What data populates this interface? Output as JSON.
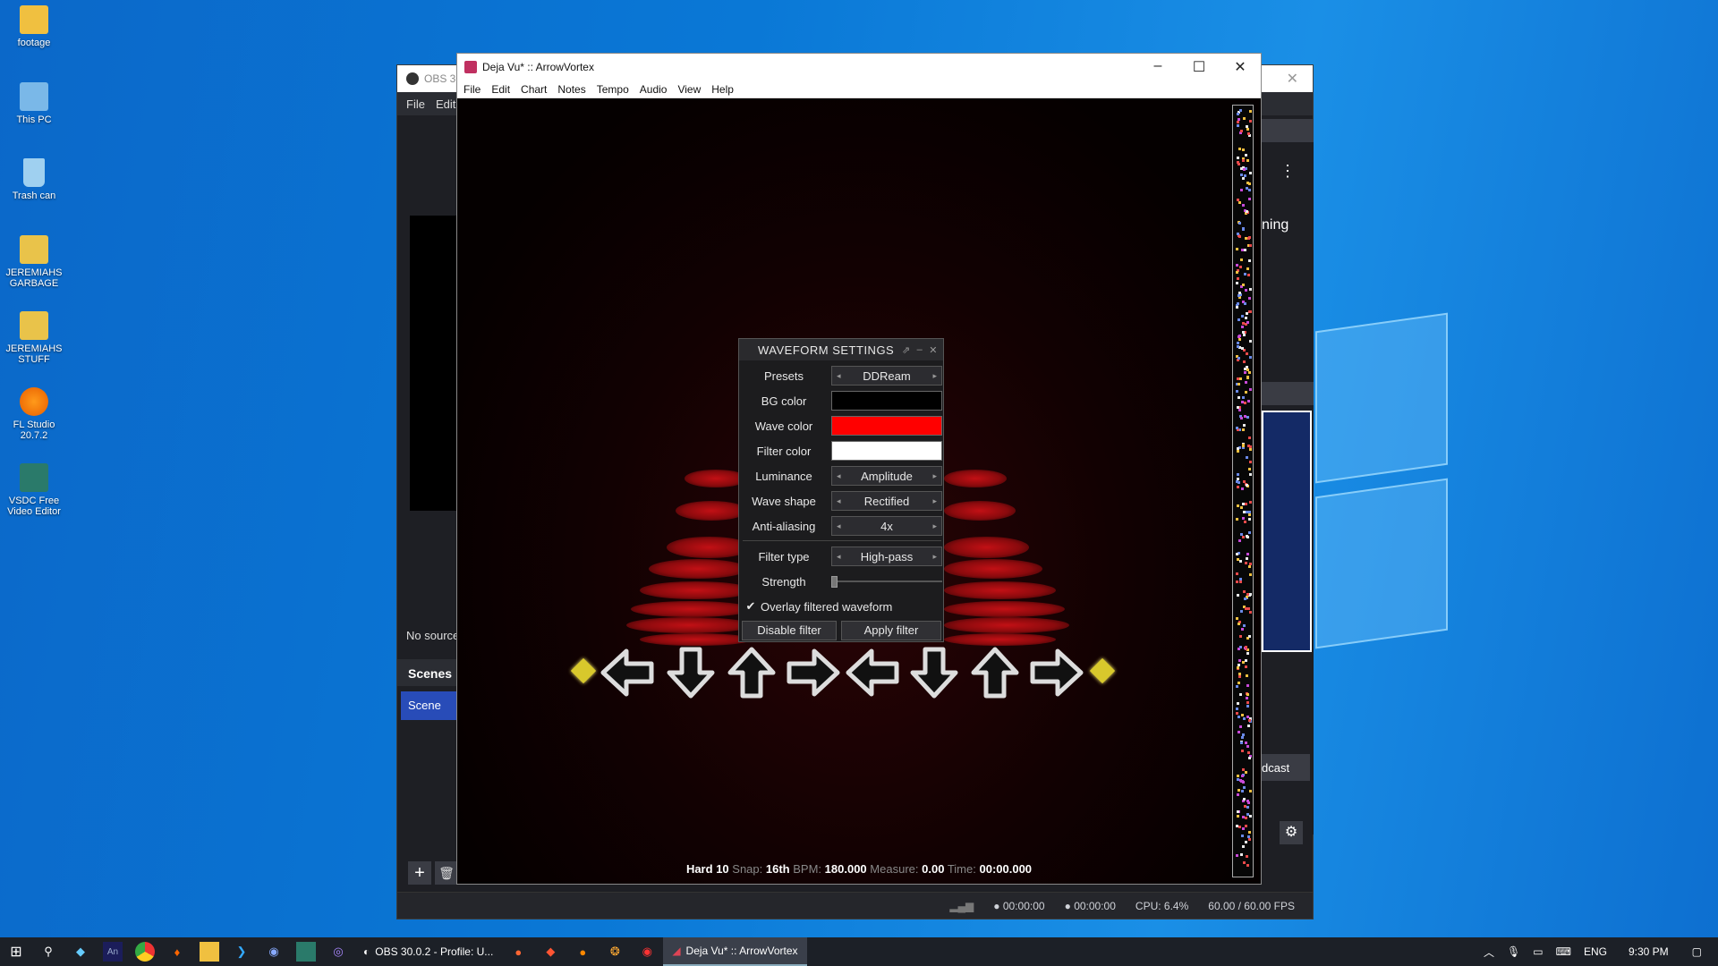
{
  "desktop": {
    "icons": [
      {
        "label": "footage"
      },
      {
        "label": "This PC"
      },
      {
        "label": "Trash can"
      },
      {
        "label": "JEREMIAHS GARBAGE"
      },
      {
        "label": "JEREMIAHS STUFF"
      },
      {
        "label": "FL Studio 20.7.2"
      },
      {
        "label": "VSDC Free Video Editor"
      }
    ]
  },
  "obs": {
    "title": "OBS 30",
    "menu": [
      "File",
      "Edit"
    ],
    "no_source": "No source",
    "scenes_label": "Scenes",
    "scene_item": "Scene",
    "right_text": "ning",
    "broadcast": "dcast",
    "status": {
      "rec_time": "00:00:00",
      "stream_time": "00:00:00",
      "cpu": "CPU: 6.4%",
      "fps": "60.00 / 60.00 FPS"
    }
  },
  "arrowvortex": {
    "title": "Deja Vu* :: ArrowVortex",
    "menu": [
      "File",
      "Edit",
      "Chart",
      "Notes",
      "Tempo",
      "Audio",
      "View",
      "Help"
    ],
    "status": {
      "difficulty": "Hard",
      "meter": "10",
      "snap_label": "Snap:",
      "snap": "16th",
      "bpm_label": "BPM:",
      "bpm": "180.000",
      "measure_label": "Measure:",
      "measure": "0.00",
      "time_label": "Time:",
      "time": "00:00.000"
    }
  },
  "dialog": {
    "title": "WAVEFORM SETTINGS",
    "presets_label": "Presets",
    "presets_value": "DDReam",
    "bg_color_label": "BG color",
    "bg_color": "#000000",
    "wave_color_label": "Wave color",
    "wave_color": "#ff0000",
    "filter_color_label": "Filter color",
    "filter_color": "#ffffff",
    "luminance_label": "Luminance",
    "luminance_value": "Amplitude",
    "wave_shape_label": "Wave shape",
    "wave_shape_value": "Rectified",
    "antialias_label": "Anti-aliasing",
    "antialias_value": "4x",
    "filter_type_label": "Filter type",
    "filter_type_value": "High-pass",
    "strength_label": "Strength",
    "strength_value": 0,
    "overlay_label": "Overlay filtered waveform",
    "overlay_checked": true,
    "disable_btn": "Disable filter",
    "apply_btn": "Apply filter"
  },
  "taskbar": {
    "obs_app": "OBS 30.0.2 - Profile: U...",
    "av_app": "Deja Vu* :: ArrowVortex",
    "lang": "ENG",
    "clock": "9:30 PM"
  }
}
